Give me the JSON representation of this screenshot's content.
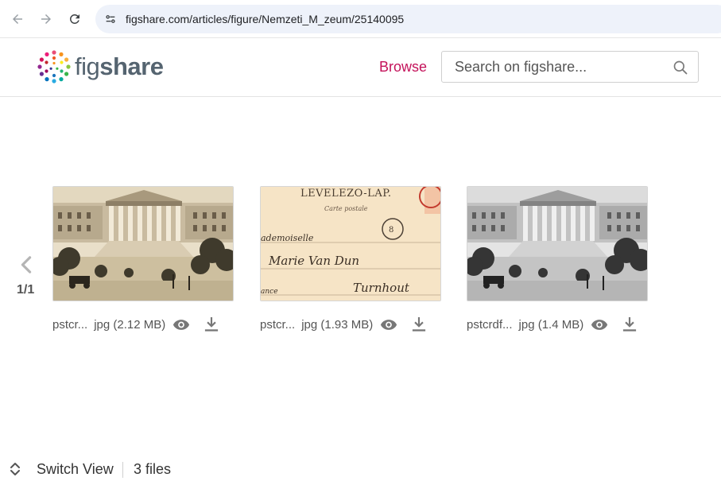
{
  "browser": {
    "url": "figshare.com/articles/figure/Nemzeti_M_zeum/25140095"
  },
  "header": {
    "logo_fig": "fig",
    "logo_share": "share",
    "browse_label": "Browse",
    "search_placeholder": "Search on figshare..."
  },
  "carousel": {
    "pager": "1/1",
    "files": [
      {
        "name": "pstcr...",
        "ext": "jpg (2.12 MB)"
      },
      {
        "name": "pstcr...",
        "ext": "jpg (1.93 MB)"
      },
      {
        "name": "pstcrdf...",
        "ext": "jpg (1.4 MB)"
      }
    ]
  },
  "postcard_text": {
    "line1": "LEVELEZO-LAP.",
    "line2": "Carte postale",
    "line3": "ademoiselle",
    "line4": "Marie Van Dun",
    "line5": "Turnhout",
    "line6": "ance"
  },
  "footer": {
    "switch_label": "Switch View",
    "file_count": "3 files"
  },
  "colors": {
    "brand_magenta": "#c4125a",
    "logo_text": "#556470"
  }
}
